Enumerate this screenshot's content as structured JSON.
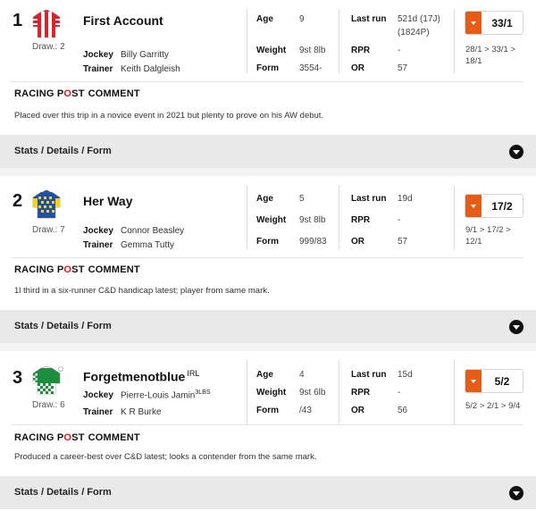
{
  "labels": {
    "draw_prefix": "Draw.: ",
    "jockey": "Jockey",
    "trainer": "Trainer",
    "age": "Age",
    "weight": "Weight",
    "form": "Form",
    "last_run": "Last run",
    "rpr": "RPR",
    "or": "OR",
    "brand_racing": "RACING P",
    "brand_o": "O",
    "brand_st": "ST",
    "comment": "COMMENT",
    "stats_details_form": "Stats / Details / Form"
  },
  "colors": {
    "odds_accent": "#e65b15",
    "brand_red": "#e0181b"
  },
  "runners": [
    {
      "number": "1",
      "draw": "Draw.: 2",
      "name": "First Account",
      "name_suffix": "",
      "jockey": "Billy Garritty",
      "jockey_allowance": "",
      "trainer": "Keith Dalgleish",
      "age": "9",
      "weight": "9st 8lb",
      "form": "3554-",
      "last_run_line1": "521d (17J)",
      "last_run_line2": "(1824P)",
      "rpr": "-",
      "or": "57",
      "odds": "33/1",
      "odds_movement_line1": "28/1 > 33/1 >",
      "odds_movement_line2": "18/1",
      "comment": "Placed over this trip in a novice event in 2021 but plenty to prove on his AW debut.",
      "silks_icon": "red-white-silks-icon"
    },
    {
      "number": "2",
      "draw": "Draw.: 7",
      "name": "Her Way",
      "name_suffix": "",
      "jockey": "Connor Beasley",
      "jockey_allowance": "",
      "trainer": "Gemma Tutty",
      "age": "5",
      "weight": "9st 8lb",
      "form": "999/83",
      "last_run_line1": "19d",
      "last_run_line2": "",
      "rpr": "-",
      "or": "57",
      "odds": "17/2",
      "odds_movement_line1": "9/1 > 17/2 >",
      "odds_movement_line2": "12/1",
      "comment": "1l third in a six-runner C&D handicap latest; player from same mark.",
      "silks_icon": "blue-yellow-silks-icon"
    },
    {
      "number": "3",
      "draw": "Draw.: 6",
      "name": "Forgetmenotblue",
      "name_suffix": "IRL",
      "jockey": "Pierre-Louis Jamin",
      "jockey_allowance": "3LBS",
      "trainer": "K R Burke",
      "age": "4",
      "weight": "9st 6lb",
      "form": "/43",
      "last_run_line1": "15d",
      "last_run_line2": "",
      "rpr": "-",
      "or": "56",
      "odds": "5/2",
      "odds_movement_line1": "5/2 > 2/1 > 9/4",
      "odds_movement_line2": "",
      "comment": "Produced a career-best over C&D latest; looks a contender from the same mark.",
      "silks_icon": "green-white-silks-icon"
    }
  ]
}
